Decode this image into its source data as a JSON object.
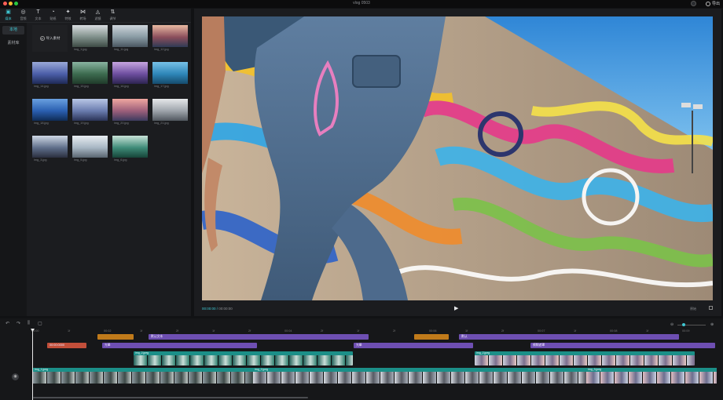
{
  "window": {
    "title": "vlog 0503",
    "export_label": "导出"
  },
  "toolbar": [
    {
      "label": "媒体",
      "icon": "▣",
      "active": true
    },
    {
      "label": "音频",
      "icon": "◎"
    },
    {
      "label": "文本",
      "icon": "T"
    },
    {
      "label": "贴纸",
      "icon": "◔"
    },
    {
      "label": "特效",
      "icon": "✦"
    },
    {
      "label": "转场",
      "icon": "⋈"
    },
    {
      "label": "滤镜",
      "icon": "◬"
    },
    {
      "label": "调节",
      "icon": "⇅"
    }
  ],
  "sidebar": [
    {
      "label": "本地",
      "active": true
    },
    {
      "label": "素材库"
    }
  ],
  "media": {
    "import_label": "导入素材",
    "items": [
      {
        "name": "img_1.jpg",
        "colors": [
          "#d9dde0",
          "#7f8f8a",
          "#3d4a44"
        ]
      },
      {
        "name": "img_11.jpg",
        "colors": [
          "#cfd6dc",
          "#889aa3",
          "#4a5660"
        ]
      },
      {
        "name": "img_12.jpg",
        "colors": [
          "#e9b9a2",
          "#8b4e5b",
          "#2f3a55"
        ]
      },
      {
        "name": "img_14.jpg",
        "colors": [
          "#9aa9d8",
          "#4b5ea8",
          "#1e2a55"
        ]
      },
      {
        "name": "img_15.jpg",
        "colors": [
          "#8ab4a1",
          "#3d6b4f",
          "#1f3a2a"
        ]
      },
      {
        "name": "img_16.jpg",
        "colors": [
          "#c6a5e0",
          "#6d4e9f",
          "#2c2450"
        ]
      },
      {
        "name": "img_17.jpg",
        "colors": [
          "#77c1e8",
          "#2e86b8",
          "#154b6c"
        ]
      },
      {
        "name": "img_18.jpg",
        "colors": [
          "#6aa1e0",
          "#2a5fb0",
          "#0f2b55"
        ]
      },
      {
        "name": "img_19.jpg",
        "colors": [
          "#b9c7e6",
          "#6a7cae",
          "#2a3356"
        ]
      },
      {
        "name": "img_20.jpg",
        "colors": [
          "#f0a7a0",
          "#9c5f7a",
          "#3b3a5e"
        ]
      },
      {
        "name": "img_21.jpg",
        "colors": [
          "#e6e8ea",
          "#9ea4ab",
          "#50575e"
        ]
      },
      {
        "name": "img_3.jpg",
        "colors": [
          "#cfd8e6",
          "#5f6f8a",
          "#2b2f3f"
        ]
      },
      {
        "name": "img_5.jpg",
        "colors": [
          "#e9eef2",
          "#a7b6c3",
          "#5a6570"
        ]
      },
      {
        "name": "img_6.jpg",
        "colors": [
          "#c9e3d8",
          "#3e8b78",
          "#164438"
        ]
      }
    ]
  },
  "preview": {
    "current_time": "00:00:00",
    "total_time": "00:00:00",
    "ratio_label": "原始"
  },
  "timeline": {
    "ticks": [
      "00:00",
      "1f",
      "00:02",
      "1f",
      "2f",
      "1f",
      "2f",
      "00:04",
      "2f",
      "1f",
      "2f",
      "00:06",
      "1f",
      "2f",
      "00:07",
      "1f",
      "00:08",
      "1f",
      "00:09"
    ],
    "text_clips": [
      {
        "label": "",
        "color": "#c07a1a",
        "track": 0,
        "start": 124,
        "width": 46
      },
      {
        "label": "默认文本",
        "color": "#6e4fb2",
        "track": 0,
        "start": 189,
        "width": 280
      },
      {
        "label": "",
        "color": "#c07a1a",
        "track": 0,
        "start": 527,
        "width": 44
      },
      {
        "label": "默认",
        "color": "#6e4fb2",
        "track": 0,
        "start": 584,
        "width": 280
      },
      {
        "label": "00:00:0000",
        "color": "#c24f3a",
        "track": 1,
        "start": 60,
        "width": 50
      },
      {
        "label": "光晕",
        "color": "#6e4fb2",
        "track": 1,
        "start": 130,
        "width": 197
      },
      {
        "label": "光晕",
        "color": "#6e4fb2",
        "track": 1,
        "start": 450,
        "width": 152
      },
      {
        "label": "模糊遮罩",
        "color": "#6e4fb2",
        "track": 1,
        "start": 675,
        "width": 235
      }
    ],
    "overlay_clips": [
      {
        "label": "img_2.jpeg",
        "start": 170,
        "width": 279
      },
      {
        "label": "img_2.jpeg",
        "start": 604,
        "width": 280
      }
    ],
    "main_clips": [
      {
        "label": "img_1.jpeg",
        "start": 42,
        "width": 280
      },
      {
        "label": "img_2.jpeg",
        "start": 322,
        "width": 424
      },
      {
        "label": "img_3.jpeg",
        "start": 746,
        "width": 166
      }
    ]
  }
}
